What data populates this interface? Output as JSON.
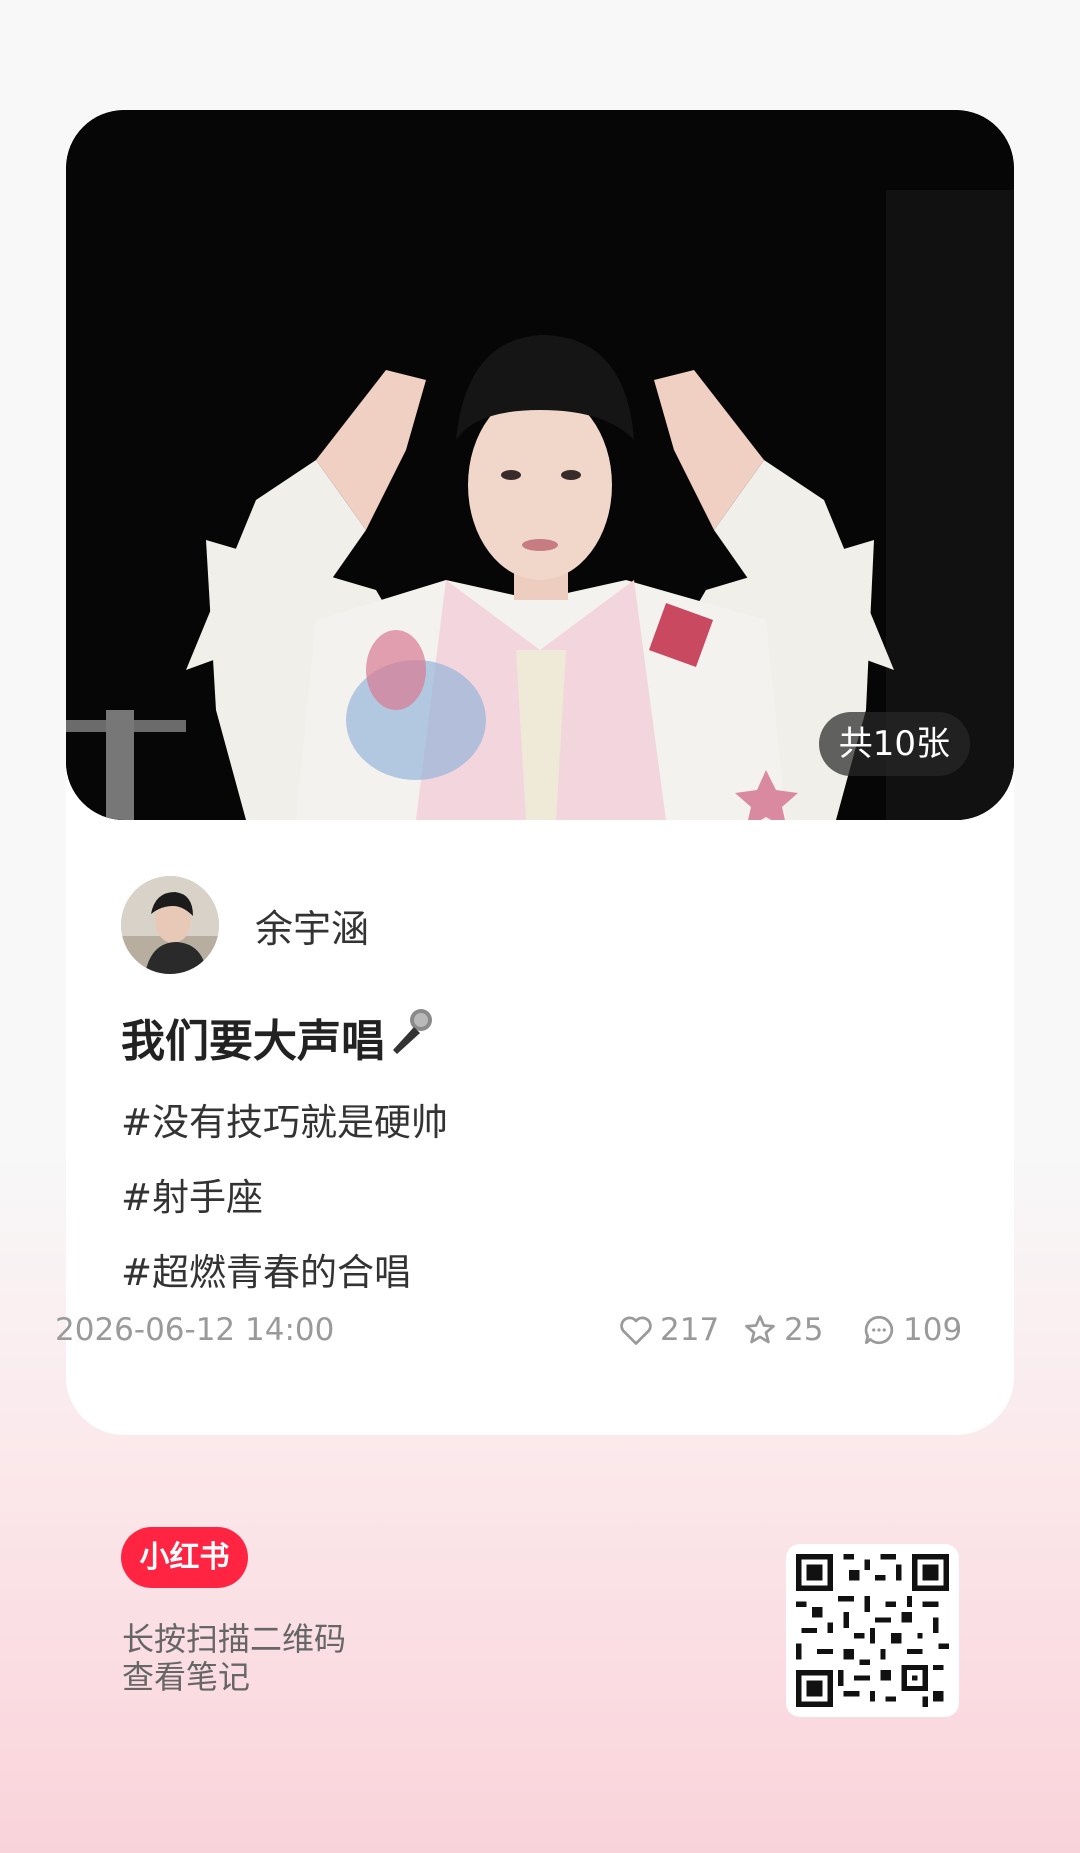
{
  "post": {
    "image_count_badge": "共10张",
    "author_name": "余宇涵",
    "title": "我们要大声唱",
    "title_emoji": "🎤",
    "tags": [
      "#没有技巧就是硬帅",
      "#射手座",
      "#超燃青春的合唱"
    ],
    "date": "2026-06-12 14:00",
    "likes": "217",
    "favorites": "25",
    "comments": "109"
  },
  "footer": {
    "brand": "小红书",
    "hint_line1": "长按扫描二维码",
    "hint_line2": "查看笔记"
  },
  "colors": {
    "brand_red": "#ff2442",
    "background_pink": "#f9d3da"
  },
  "icons": [
    "heart-icon",
    "star-icon",
    "comment-icon",
    "microphone-icon",
    "qr-code"
  ]
}
